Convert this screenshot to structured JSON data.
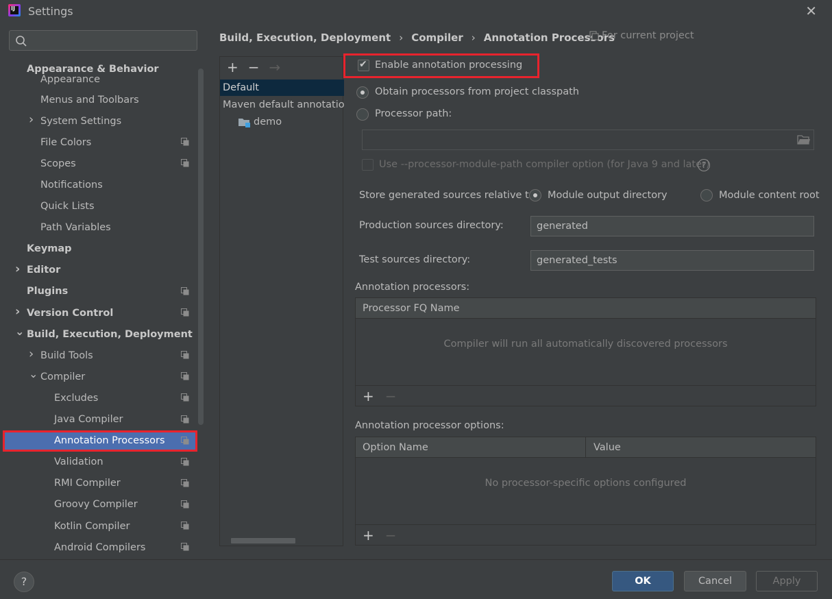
{
  "window": {
    "title": "Settings",
    "app_icon_text": "IJ"
  },
  "search": {
    "placeholder": ""
  },
  "sidebar": {
    "items": [
      {
        "label": "Appearance & Behavior",
        "bold": true,
        "indent": 0,
        "chevron": "",
        "config": false
      },
      {
        "label": "Appearance",
        "bold": false,
        "indent": 1,
        "chevron": "",
        "config": false
      },
      {
        "label": "Menus and Toolbars",
        "bold": false,
        "indent": 1,
        "chevron": "",
        "config": false
      },
      {
        "label": "System Settings",
        "bold": false,
        "indent": 1,
        "chevron": "right",
        "config": false
      },
      {
        "label": "File Colors",
        "bold": false,
        "indent": 1,
        "chevron": "",
        "config": true
      },
      {
        "label": "Scopes",
        "bold": false,
        "indent": 1,
        "chevron": "",
        "config": true
      },
      {
        "label": "Notifications",
        "bold": false,
        "indent": 1,
        "chevron": "",
        "config": false
      },
      {
        "label": "Quick Lists",
        "bold": false,
        "indent": 1,
        "chevron": "",
        "config": false
      },
      {
        "label": "Path Variables",
        "bold": false,
        "indent": 1,
        "chevron": "",
        "config": false
      },
      {
        "label": "Keymap",
        "bold": true,
        "indent": 0,
        "chevron": "",
        "config": false
      },
      {
        "label": "Editor",
        "bold": true,
        "indent": 0,
        "chevron": "right",
        "config": false
      },
      {
        "label": "Plugins",
        "bold": true,
        "indent": 0,
        "chevron": "",
        "config": true
      },
      {
        "label": "Version Control",
        "bold": true,
        "indent": 0,
        "chevron": "right",
        "config": true
      },
      {
        "label": "Build, Execution, Deployment",
        "bold": true,
        "indent": 0,
        "chevron": "down",
        "config": false
      },
      {
        "label": "Build Tools",
        "bold": false,
        "indent": 1,
        "chevron": "right",
        "config": true
      },
      {
        "label": "Compiler",
        "bold": false,
        "indent": 1,
        "chevron": "down",
        "config": true
      },
      {
        "label": "Excludes",
        "bold": false,
        "indent": 2,
        "chevron": "",
        "config": true
      },
      {
        "label": "Java Compiler",
        "bold": false,
        "indent": 2,
        "chevron": "",
        "config": true
      },
      {
        "label": "Annotation Processors",
        "bold": false,
        "indent": 2,
        "chevron": "",
        "config": true,
        "selected": true
      },
      {
        "label": "Validation",
        "bold": false,
        "indent": 2,
        "chevron": "",
        "config": true
      },
      {
        "label": "RMI Compiler",
        "bold": false,
        "indent": 2,
        "chevron": "",
        "config": true
      },
      {
        "label": "Groovy Compiler",
        "bold": false,
        "indent": 2,
        "chevron": "",
        "config": true
      },
      {
        "label": "Kotlin Compiler",
        "bold": false,
        "indent": 2,
        "chevron": "",
        "config": true
      },
      {
        "label": "Android Compilers",
        "bold": false,
        "indent": 2,
        "chevron": "",
        "config": true
      }
    ]
  },
  "breadcrumb": {
    "items": [
      "Build, Execution, Deployment",
      "Compiler",
      "Annotation Processors"
    ],
    "separator": "›",
    "scope": "For current project"
  },
  "profiles": {
    "toolbar": {
      "add": "+",
      "remove": "−",
      "move": "→"
    },
    "items": [
      "Default",
      "Maven default annotation processors profile",
      "demo"
    ]
  },
  "options": {
    "enable_annotation_processing": "Enable annotation processing",
    "obtain_from_classpath": "Obtain processors from project classpath",
    "processor_path": "Processor path:",
    "processor_path_value": "",
    "module_path_option": "Use --processor-module-path compiler option (for Java 9 and later)",
    "store_label": "Store generated sources relative to:",
    "module_output_dir": "Module output directory",
    "module_content_root": "Module content root",
    "production_label": "Production sources directory:",
    "production_value": "generated",
    "test_label": "Test sources directory:",
    "test_value": "generated_tests"
  },
  "processors_table": {
    "title": "Annotation processors:",
    "column": "Processor FQ Name",
    "empty": "Compiler will run all automatically discovered processors",
    "add": "+",
    "remove": "−"
  },
  "options_table": {
    "title": "Annotation processor options:",
    "columns": [
      "Option Name",
      "Value"
    ],
    "empty": "No processor-specific options configured",
    "add": "+",
    "remove": "−"
  },
  "footer": {
    "help": "?",
    "ok": "OK",
    "cancel": "Cancel",
    "apply": "Apply"
  },
  "colors": {
    "background": "#3c3f41",
    "selection": "#4b6eaf",
    "highlight": "#e8232d",
    "primary_button": "#365880"
  }
}
